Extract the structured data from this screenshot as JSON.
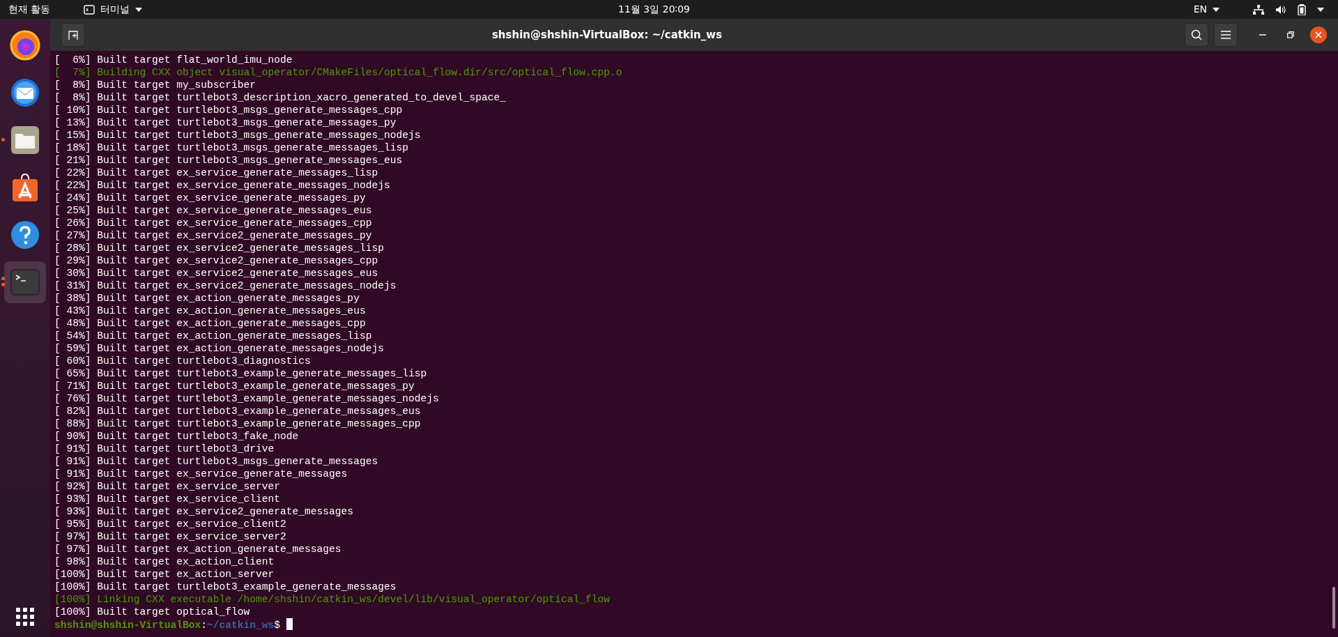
{
  "top_bar": {
    "activities": "현재 활동",
    "app_menu": "터미널",
    "clock": "11월 3일 20∶09",
    "keyboard": "EN"
  },
  "dock": {
    "items": [
      {
        "kind": "firefox",
        "running": false,
        "multiple_windows": false,
        "selected": false
      },
      {
        "kind": "mail",
        "running": false,
        "multiple_windows": false,
        "selected": false
      },
      {
        "kind": "files",
        "running": true,
        "multiple_windows": false,
        "selected": false
      },
      {
        "kind": "software",
        "running": false,
        "multiple_windows": false,
        "selected": false
      },
      {
        "kind": "help",
        "running": false,
        "multiple_windows": false,
        "selected": false
      },
      {
        "kind": "terminal",
        "running": true,
        "multiple_windows": true,
        "selected": true
      }
    ]
  },
  "window": {
    "title": "shshin@shshin-VirtualBox: ~/catkin_ws"
  },
  "terminal": {
    "lines": [
      {
        "kind": "normal",
        "text": "[  6%] Built target flat_world_imu_node"
      },
      {
        "kind": "green",
        "text": "[  7%] Building CXX object visual_operator/CMakeFiles/optical_flow.dir/src/optical_flow.cpp.o"
      },
      {
        "kind": "normal",
        "text": "[  8%] Built target my_subscriber"
      },
      {
        "kind": "normal",
        "text": "[  8%] Built target turtlebot3_description_xacro_generated_to_devel_space_"
      },
      {
        "kind": "normal",
        "text": "[ 10%] Built target turtlebot3_msgs_generate_messages_cpp"
      },
      {
        "kind": "normal",
        "text": "[ 13%] Built target turtlebot3_msgs_generate_messages_py"
      },
      {
        "kind": "normal",
        "text": "[ 15%] Built target turtlebot3_msgs_generate_messages_nodejs"
      },
      {
        "kind": "normal",
        "text": "[ 18%] Built target turtlebot3_msgs_generate_messages_lisp"
      },
      {
        "kind": "normal",
        "text": "[ 21%] Built target turtlebot3_msgs_generate_messages_eus"
      },
      {
        "kind": "normal",
        "text": "[ 22%] Built target ex_service_generate_messages_lisp"
      },
      {
        "kind": "normal",
        "text": "[ 22%] Built target ex_service_generate_messages_nodejs"
      },
      {
        "kind": "normal",
        "text": "[ 24%] Built target ex_service_generate_messages_py"
      },
      {
        "kind": "normal",
        "text": "[ 25%] Built target ex_service_generate_messages_eus"
      },
      {
        "kind": "normal",
        "text": "[ 26%] Built target ex_service_generate_messages_cpp"
      },
      {
        "kind": "normal",
        "text": "[ 27%] Built target ex_service2_generate_messages_py"
      },
      {
        "kind": "normal",
        "text": "[ 28%] Built target ex_service2_generate_messages_lisp"
      },
      {
        "kind": "normal",
        "text": "[ 29%] Built target ex_service2_generate_messages_cpp"
      },
      {
        "kind": "normal",
        "text": "[ 30%] Built target ex_service2_generate_messages_eus"
      },
      {
        "kind": "normal",
        "text": "[ 31%] Built target ex_service2_generate_messages_nodejs"
      },
      {
        "kind": "normal",
        "text": "[ 38%] Built target ex_action_generate_messages_py"
      },
      {
        "kind": "normal",
        "text": "[ 43%] Built target ex_action_generate_messages_eus"
      },
      {
        "kind": "normal",
        "text": "[ 48%] Built target ex_action_generate_messages_cpp"
      },
      {
        "kind": "normal",
        "text": "[ 54%] Built target ex_action_generate_messages_lisp"
      },
      {
        "kind": "normal",
        "text": "[ 59%] Built target ex_action_generate_messages_nodejs"
      },
      {
        "kind": "normal",
        "text": "[ 60%] Built target turtlebot3_diagnostics"
      },
      {
        "kind": "normal",
        "text": "[ 65%] Built target turtlebot3_example_generate_messages_lisp"
      },
      {
        "kind": "normal",
        "text": "[ 71%] Built target turtlebot3_example_generate_messages_py"
      },
      {
        "kind": "normal",
        "text": "[ 76%] Built target turtlebot3_example_generate_messages_nodejs"
      },
      {
        "kind": "normal",
        "text": "[ 82%] Built target turtlebot3_example_generate_messages_eus"
      },
      {
        "kind": "normal",
        "text": "[ 88%] Built target turtlebot3_example_generate_messages_cpp"
      },
      {
        "kind": "normal",
        "text": "[ 90%] Built target turtlebot3_fake_node"
      },
      {
        "kind": "normal",
        "text": "[ 91%] Built target turtlebot3_drive"
      },
      {
        "kind": "normal",
        "text": "[ 91%] Built target turtlebot3_msgs_generate_messages"
      },
      {
        "kind": "normal",
        "text": "[ 91%] Built target ex_service_generate_messages"
      },
      {
        "kind": "normal",
        "text": "[ 92%] Built target ex_service_server"
      },
      {
        "kind": "normal",
        "text": "[ 93%] Built target ex_service_client"
      },
      {
        "kind": "normal",
        "text": "[ 93%] Built target ex_service2_generate_messages"
      },
      {
        "kind": "normal",
        "text": "[ 95%] Built target ex_service_client2"
      },
      {
        "kind": "normal",
        "text": "[ 97%] Built target ex_service_server2"
      },
      {
        "kind": "normal",
        "text": "[ 97%] Built target ex_action_generate_messages"
      },
      {
        "kind": "normal",
        "text": "[ 98%] Built target ex_action_client"
      },
      {
        "kind": "normal",
        "text": "[100%] Built target ex_action_server"
      },
      {
        "kind": "normal",
        "text": "[100%] Built target turtlebot3_example_generate_messages"
      },
      {
        "kind": "green",
        "text": "[100%] Linking CXX executable /home/shshin/catkin_ws/devel/lib/visual_operator/optical_flow"
      },
      {
        "kind": "normal",
        "text": "[100%] Built target optical_flow"
      }
    ],
    "prompt": {
      "user_host": "shshin@shshin-VirtualBox",
      "separator": ":",
      "path": "~/catkin_ws",
      "symbol": "$"
    }
  }
}
